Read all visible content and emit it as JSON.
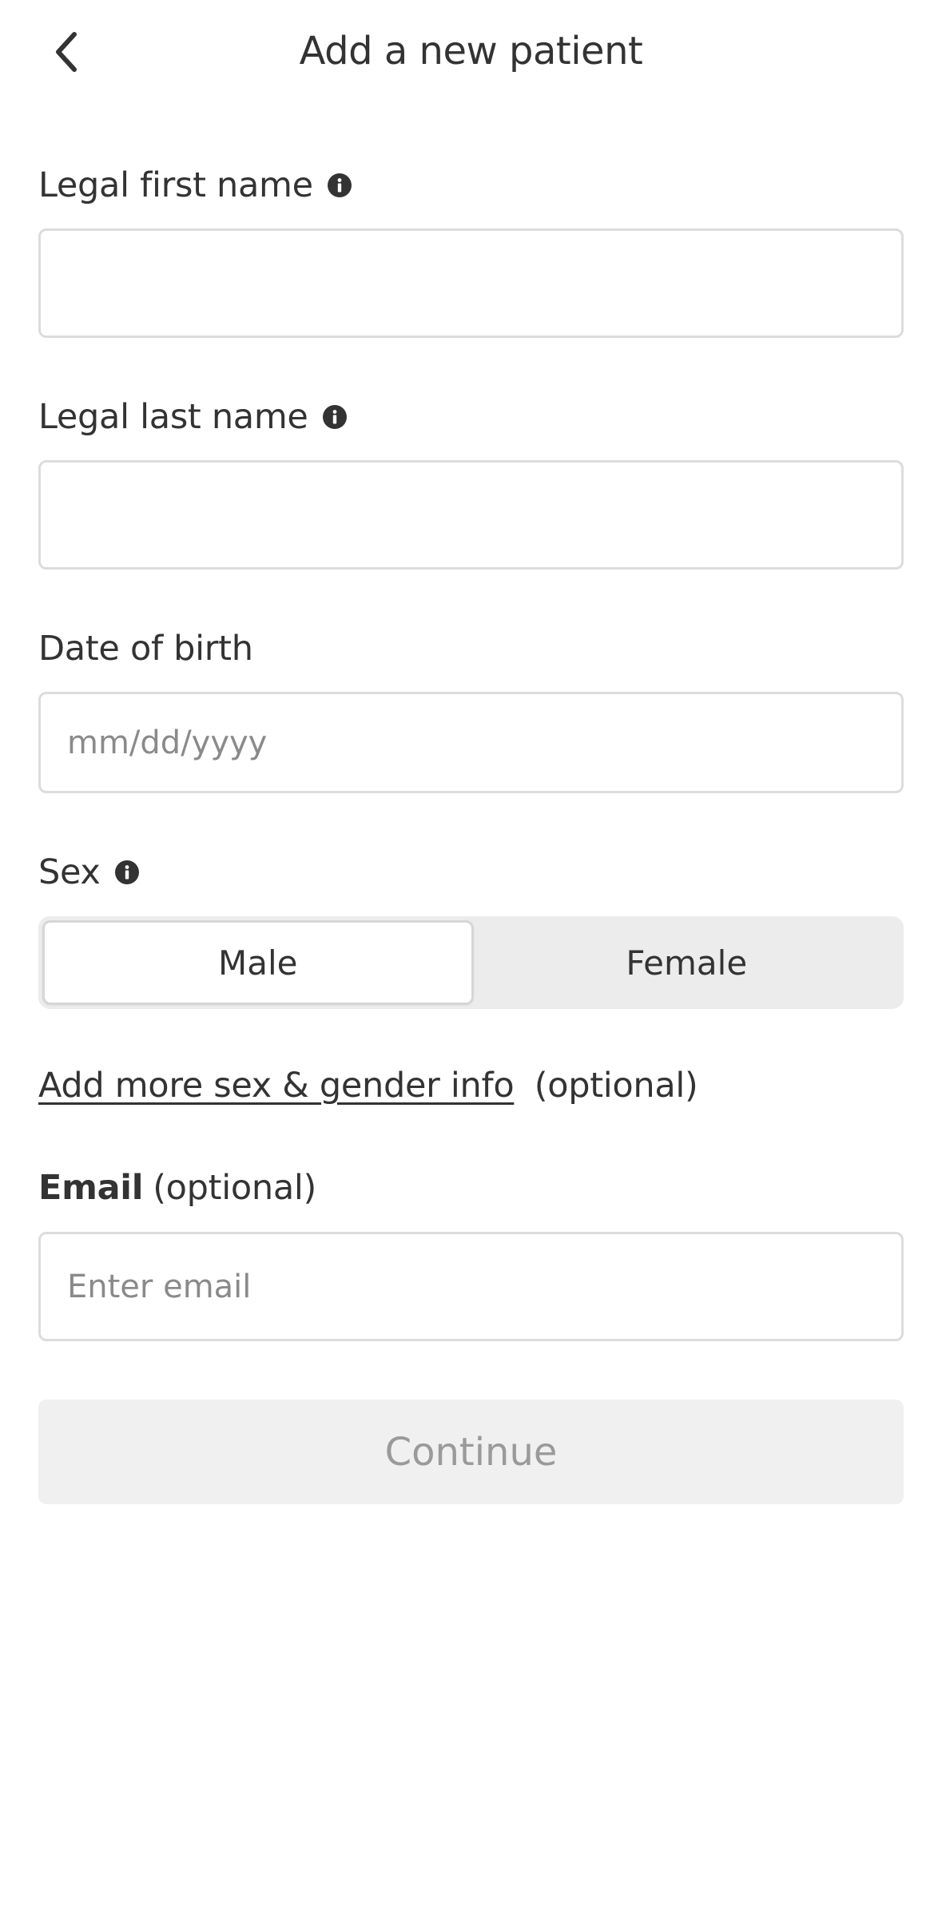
{
  "header": {
    "title": "Add a new patient",
    "back_icon": "chevron-left-icon"
  },
  "form": {
    "first_name": {
      "label": "Legal first name",
      "value": "",
      "placeholder": ""
    },
    "last_name": {
      "label": "Legal last name",
      "value": "",
      "placeholder": ""
    },
    "dob": {
      "label": "Date of birth",
      "value": "",
      "placeholder": "mm/dd/yyyy"
    },
    "sex": {
      "label": "Sex",
      "options": [
        "Male",
        "Female"
      ],
      "selected": "Male"
    },
    "more_info": {
      "link_label": "Add more sex & gender info",
      "suffix": "(optional)"
    },
    "email": {
      "label": "Email",
      "optional": "(optional)",
      "value": "",
      "placeholder": "Enter email"
    },
    "continue_label": "Continue"
  },
  "colors": {
    "text": "#333333",
    "border": "#dcdcdc",
    "placeholder": "#8a8a8a",
    "segment_bg": "#ececec",
    "disabled_bg": "#f0f0f0",
    "disabled_text": "#9a9a9a"
  }
}
